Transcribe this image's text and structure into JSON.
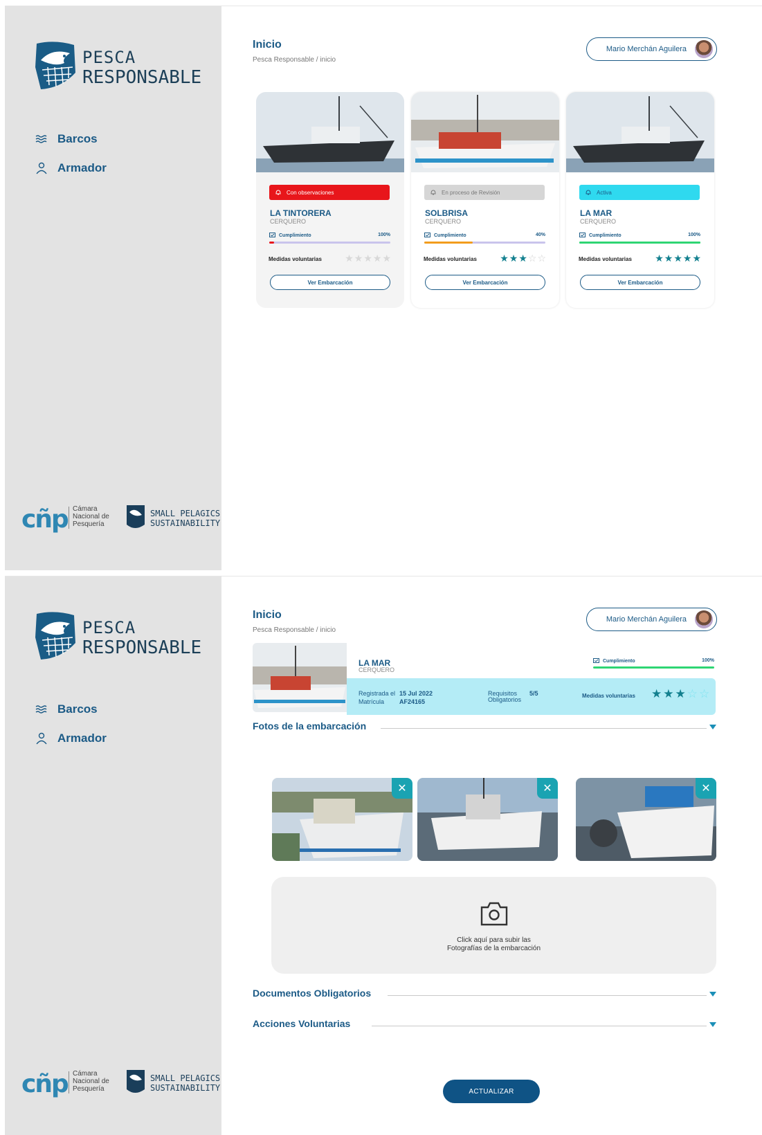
{
  "brand": {
    "line1": "PESCA",
    "line2": "RESPONSABLE"
  },
  "nav": [
    {
      "label": "Barcos",
      "icon": "waves-icon"
    },
    {
      "label": "Armador",
      "icon": "user-icon"
    }
  ],
  "partners": {
    "cnp_logo": "cñp",
    "cnp_text": "Cámara Nacional de Pesquería",
    "sps_line1": "SMALL PELAGICS",
    "sps_line2": "SUSTAINABILITY"
  },
  "header": {
    "title": "Inicio",
    "breadcrumb": "Pesca Responsable / inicio",
    "user_name": "Mario Merchán Aguilera"
  },
  "colors": {
    "primary": "#1b5a86",
    "status_observaciones": "#e8161b",
    "status_revision": "#d6d6d6",
    "status_activa": "#2fd9ef",
    "progress_full": "#2ed573",
    "progress_partial": "#f29d1d",
    "star_active": "#13808f"
  },
  "boats": [
    {
      "status": "Con observaciones",
      "status_key": "observaciones",
      "name": "LA TINTORERA",
      "type": "CERQUERO",
      "cumplimiento_label": "Cumplimiento",
      "cumplimiento_pct": "100%",
      "progress": 0.04,
      "progress_color": "#e8161b",
      "medidas_label": "Medidas voluntarias",
      "stars": 0,
      "button": "Ver Embarcación"
    },
    {
      "status": "En proceso de Revisión",
      "status_key": "revision",
      "name": "SOLBRISA",
      "type": "CERQUERO",
      "cumplimiento_label": "Cumplimiento",
      "cumplimiento_pct": "40%",
      "progress": 0.4,
      "progress_color": "#f29d1d",
      "medidas_label": "Medidas voluntarias",
      "stars": 3,
      "button": "Ver Embarcación"
    },
    {
      "status": "Activa",
      "status_key": "activa",
      "name": "LA MAR",
      "type": "CERQUERO",
      "cumplimiento_label": "Cumplimiento",
      "cumplimiento_pct": "100%",
      "progress": 1.0,
      "progress_color": "#2ed573",
      "medidas_label": "Medidas voluntarias",
      "stars": 5,
      "button": "Ver Embarcación"
    }
  ],
  "detail": {
    "name": "LA MAR",
    "type": "CERQUERO",
    "cumplimiento_label": "Cumplimiento",
    "cumplimiento_pct": "100%",
    "registrada_label": "Registrada el",
    "registrada_value": "15 Jul 2022",
    "matricula_label": "Matrícula",
    "matricula_value": "AF24165",
    "requisitos_label_1": "Requisitos",
    "requisitos_label_2": "Obligatorios",
    "requisitos_value": "5/5",
    "medidas_label": "Medidas voluntarias",
    "stars": 3
  },
  "sections": {
    "fotos": "Fotos de la embarcación",
    "documentos": "Documentos Obligatorios",
    "acciones": "Acciones Voluntarias"
  },
  "upload": {
    "line1": "Click aquí para subir las",
    "line2": "Fotografías de la embarcación"
  },
  "actions": {
    "update": "ACTUALIZAR"
  }
}
